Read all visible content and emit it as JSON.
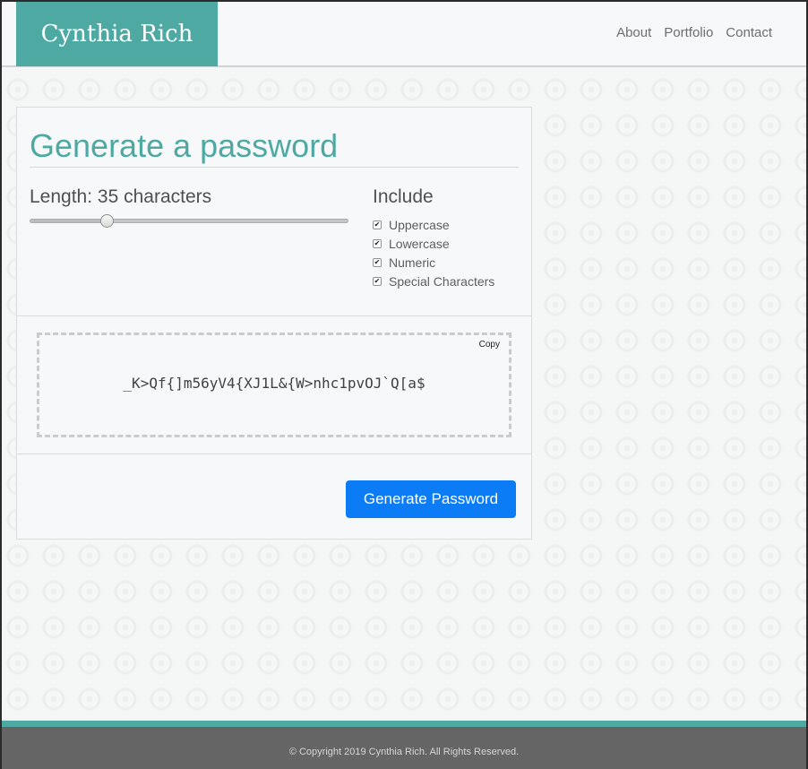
{
  "header": {
    "brand": "Cynthia Rich",
    "nav": [
      "About",
      "Portfolio",
      "Contact"
    ]
  },
  "generator": {
    "title": "Generate a password",
    "length_label": "Length: 35 characters",
    "length_value": 35,
    "slider_fraction": 0.24,
    "include_title": "Include",
    "options": [
      {
        "label": "Uppercase",
        "checked": true
      },
      {
        "label": "Lowercase",
        "checked": true
      },
      {
        "label": "Numeric",
        "checked": true
      },
      {
        "label": "Special Characters",
        "checked": true
      }
    ],
    "copy_label": "Copy",
    "password": "_K>Qf{]m56yV4{XJ1L&{W>nhc1pvOJ`Q[a$",
    "generate_label": "Generate Password"
  },
  "footer": {
    "copyright": "© Copyright 2019 Cynthia Rich. All Rights Reserved."
  },
  "colors": {
    "accent": "#4fa9a3",
    "button": "#0b7cf5",
    "footer_bg": "#656565"
  }
}
